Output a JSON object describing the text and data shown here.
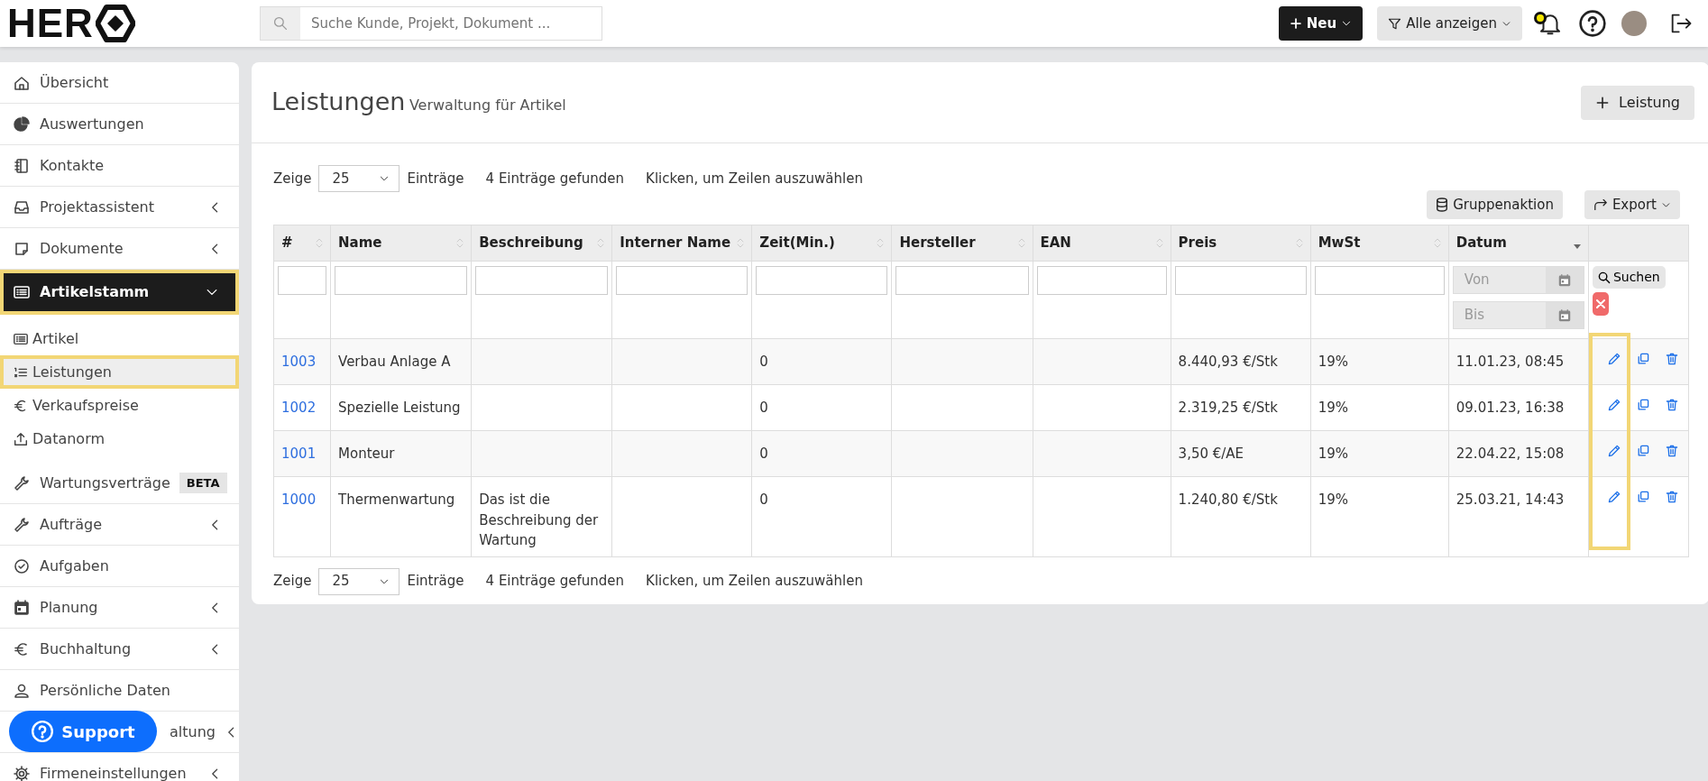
{
  "header": {
    "logo": "HER",
    "search": {
      "placeholder": "Suche Kunde, Projekt, Dokument ..."
    },
    "new_button": "Neu",
    "filter_button": "Alle anzeigen",
    "notification_dot": true
  },
  "sidebar": {
    "items": [
      {
        "label": "Übersicht",
        "selected": false
      },
      {
        "label": "Auswertungen",
        "selected": false
      },
      {
        "label": "Kontakte",
        "selected": false
      },
      {
        "label": "Projektassistent",
        "selected": false,
        "expanded": false
      },
      {
        "label": "Dokumente",
        "selected": false,
        "expanded": false
      },
      {
        "label": "Artikelstamm",
        "selected": true,
        "highlighted": true,
        "expanded": true,
        "children": [
          {
            "label": "Artikel",
            "selected": false,
            "highlighted": false
          },
          {
            "label": "Leistungen",
            "selected": true,
            "highlighted": true
          },
          {
            "label": "Verkaufspreise",
            "selected": false,
            "highlighted": false
          },
          {
            "label": "Datanorm",
            "selected": false,
            "highlighted": false
          }
        ]
      },
      {
        "label": "Wartungsverträge",
        "selected": false,
        "badge": "BETA"
      },
      {
        "label": "Aufträge",
        "selected": false,
        "expanded": false
      },
      {
        "label": "Aufgaben",
        "selected": false
      },
      {
        "label": "Planung",
        "selected": false,
        "expanded": false
      },
      {
        "label": "Buchhaltung",
        "selected": false,
        "expanded": false
      },
      {
        "label": "Persönliche Daten",
        "selected": false
      },
      {
        "label": "altung",
        "selected": false,
        "expanded": false
      },
      {
        "label": "Firmeneinstellungen",
        "selected": false,
        "expanded": false
      }
    ]
  },
  "support_button": "Support",
  "page": {
    "title": "Leistungen",
    "subtitle": "Verwaltung für Artikel",
    "add_button": "Leistung"
  },
  "table_controls": {
    "show_label": "Zeige",
    "page_size": "25",
    "entries_label": "Einträge",
    "found": "4 Einträge gefunden",
    "hint": "Klicken, um Zeilen auszuwählen",
    "group_button": "Gruppenaktion",
    "export_button": "Export"
  },
  "table": {
    "columns": [
      {
        "label": "#",
        "sorted": false
      },
      {
        "label": "Name",
        "sorted": false
      },
      {
        "label": "Beschreibung",
        "sorted": false
      },
      {
        "label": "Interner Name",
        "sorted": false
      },
      {
        "label": "Zeit(Min.)",
        "sorted": false
      },
      {
        "label": "Hersteller",
        "sorted": false
      },
      {
        "label": "EAN",
        "sorted": false
      },
      {
        "label": "Preis",
        "sorted": false
      },
      {
        "label": "MwSt",
        "sorted": false
      },
      {
        "label": "Datum",
        "sorted": true
      }
    ],
    "date_from_placeholder": "Von",
    "date_to_placeholder": "Bis",
    "search_button": "Suchen",
    "edit_column_highlighted": true,
    "rows": [
      {
        "id": "1003",
        "name": "Verbau Anlage A",
        "time": "0",
        "price": "8.440,93 €/Stk",
        "vat": "19%",
        "date": "11.01.23, 08:45"
      },
      {
        "id": "1002",
        "name": "Spezielle Leistung",
        "time": "0",
        "price": "2.319,25 €/Stk",
        "vat": "19%",
        "date": "09.01.23, 16:38"
      },
      {
        "id": "1001",
        "name": "Monteur",
        "time": "0",
        "price": "3,50 €/AE",
        "vat": "19%",
        "date": "22.04.22, 15:08"
      },
      {
        "id": "1000",
        "name": "Thermenwartung",
        "description": "Das ist die Beschreibung der Wartung",
        "time": "0",
        "price": "1.240,80 €/Stk",
        "vat": "19%",
        "date": "25.03.21, 14:43"
      }
    ]
  },
  "bottom_controls": {
    "show_label": "Zeige",
    "page_size": "25",
    "entries_label": "Einträge",
    "found": "4 Einträge gefunden",
    "hint": "Klicken, um Zeilen auszuwählen"
  }
}
